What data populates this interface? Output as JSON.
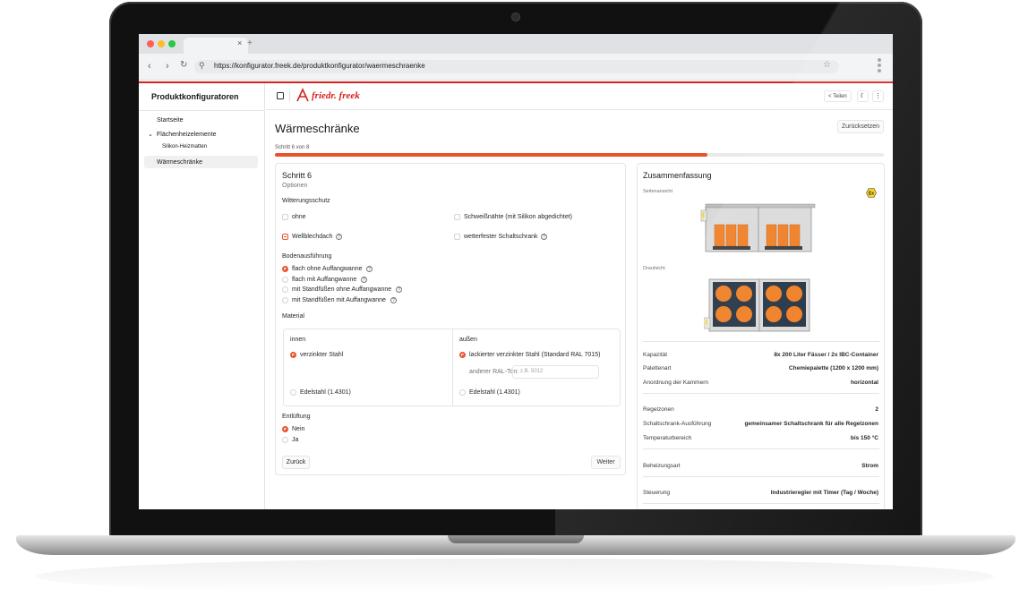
{
  "browser": {
    "url": "https://konfigurator.freek.de/produktkonfigurator/waermeschraenke",
    "tab_close": "×",
    "tab_new": "+"
  },
  "sidebar": {
    "title": "Produktkonfiguratoren",
    "items": [
      {
        "label": "Startseite"
      },
      {
        "label": "Flächenheizelemente"
      },
      {
        "label": "Silikon-Heizmatten"
      },
      {
        "label": "Wärmeschränke"
      }
    ]
  },
  "header": {
    "logo_text": "friedr. freek",
    "share_label": "Teilen"
  },
  "page": {
    "title": "Wärmeschränke",
    "reset_label": "Zurücksetzen",
    "step_text": "Schritt 6 von 8",
    "progress": 0.71
  },
  "form": {
    "step_title": "Schritt 6",
    "step_subtitle": "Optionen",
    "weather_label": "Witterungsschutz",
    "weather_options": [
      {
        "label": "ohne",
        "checked": false
      },
      {
        "label": "Schweißnähte (mit Silikon abgedichtet)",
        "checked": false
      },
      {
        "label": "Wellblechdach",
        "checked": true
      },
      {
        "label": "wetterfester Schaltschrank",
        "checked": false
      }
    ],
    "floor_label": "Bodenausführung",
    "floor_options": [
      {
        "label": "flach ohne Auffangwanne",
        "checked": true
      },
      {
        "label": "flach mit Auffangwanne",
        "checked": false
      },
      {
        "label": "mit Standfüßen ohne Auffangwanne",
        "checked": false
      },
      {
        "label": "mit Standfüßen mit Auffangwanne",
        "checked": false
      }
    ],
    "material_label": "Material",
    "inner_label": "innen",
    "inner_options": [
      {
        "label": "verzinkter Stahl",
        "checked": true
      },
      {
        "label": "Edelstahl (1.4301)",
        "checked": false
      }
    ],
    "outer_label": "außen",
    "outer_options": [
      {
        "label": "lackierter verzinkter Stahl (Standard RAL 7015)",
        "checked": true
      },
      {
        "label": "Edelstahl (1.4301)",
        "checked": false
      }
    ],
    "ral_label": "anderer RAL-Ton:",
    "ral_placeholder": "z.B. 5012",
    "vent_label": "Entlüftung",
    "vent_options": [
      {
        "label": "Nein",
        "checked": true
      },
      {
        "label": "Ja",
        "checked": false
      }
    ],
    "back_label": "Zurück",
    "next_label": "Weiter"
  },
  "summary": {
    "title": "Zusammenfassung",
    "side_view_label": "Seitenansicht",
    "top_view_label": "Draufsicht",
    "ex_badge": "Ex",
    "rows": [
      {
        "label": "Kapazität",
        "value": "8x 200 Liter Fässer / 2x IBC-Container"
      },
      {
        "label": "Palettenart",
        "value": "Chemiepalette (1200 x 1200 mm)"
      },
      {
        "label": "Anordnung der Kammern",
        "value": "horizontal"
      },
      {
        "label": "Regelzonen",
        "value": "2"
      },
      {
        "label": "Schaltschrank-Ausführung",
        "value": "gemeinsamer Schaltschrank für alle Regelzonen"
      },
      {
        "label": "Temperaturbereich",
        "value": "bis 150 °C"
      },
      {
        "label": "Beheizungsart",
        "value": "Strom"
      },
      {
        "label": "Steuerung",
        "value": "Industrieregler mit Timer (Tag / Woche)"
      }
    ]
  },
  "colors": {
    "accent": "#e8532b",
    "brand_red": "#d4231c"
  }
}
